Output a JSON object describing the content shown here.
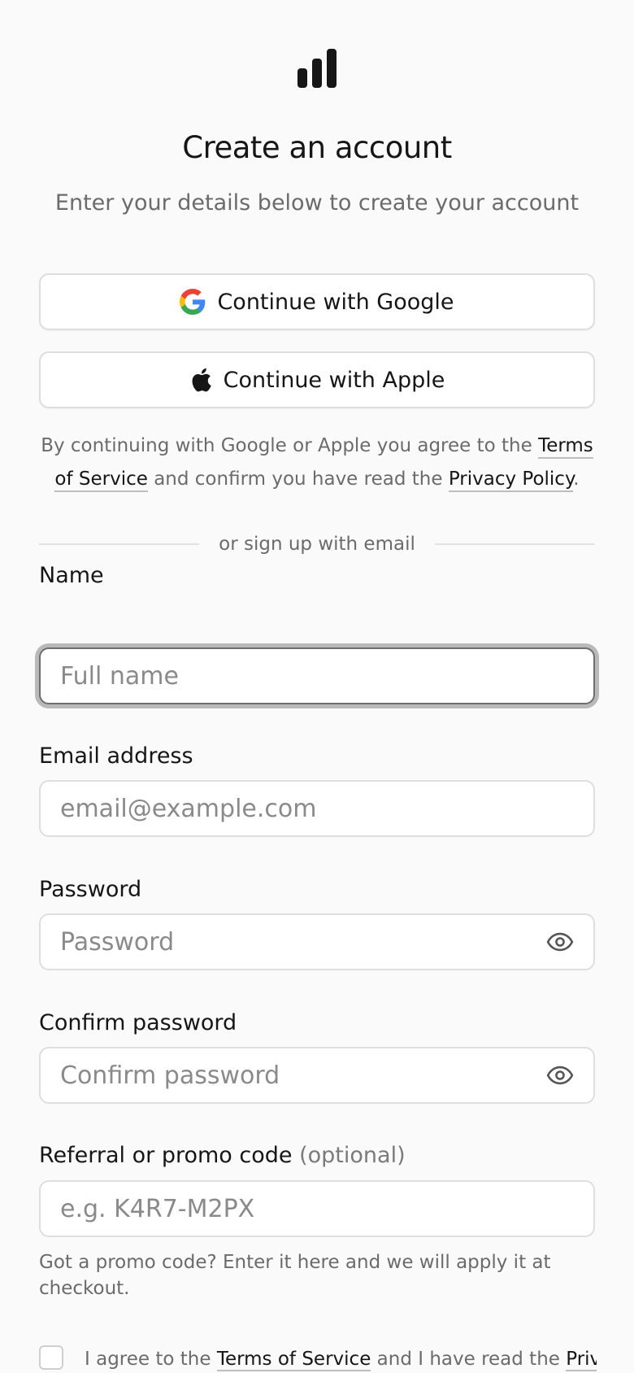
{
  "header": {
    "logo_icon": "bar-chart-icon",
    "title": "Create an account",
    "subtitle": "Enter your details below to create your account"
  },
  "social": {
    "google_label": "Continue with Google",
    "apple_label": "Continue with Apple",
    "consent_prefix": "By continuing with Google or Apple you agree to the ",
    "terms_link": "Terms of Service",
    "consent_middle": " and confirm you have read the ",
    "privacy_link": "Privacy Policy",
    "consent_suffix": "."
  },
  "divider": {
    "text": "or sign up with email"
  },
  "form": {
    "name": {
      "label": "Name",
      "placeholder": "Full name",
      "value": ""
    },
    "email": {
      "label": "Email address",
      "placeholder": "email@example.com",
      "value": ""
    },
    "password": {
      "label": "Password",
      "placeholder": "Password",
      "value": "",
      "icon": "eye-icon"
    },
    "confirm": {
      "label": "Confirm password",
      "placeholder": "Confirm password",
      "value": "",
      "icon": "eye-icon"
    },
    "promo": {
      "label": "Referral or promo code",
      "optional": "(optional)",
      "placeholder": "e.g. K4R7-M2PX",
      "value": "",
      "helper": "Got a promo code? Enter it here and we will apply it at checkout."
    }
  },
  "agree": {
    "prefix": "I agree to the ",
    "terms_link": "Terms of Service",
    "middle": " and I have read the ",
    "privacy_link": "Privacy"
  },
  "colors": {
    "background": "#fafafa",
    "text": "#161616",
    "muted": "#6b6b6b",
    "border": "#dedede",
    "focus_ring": "#b9b9b9"
  }
}
